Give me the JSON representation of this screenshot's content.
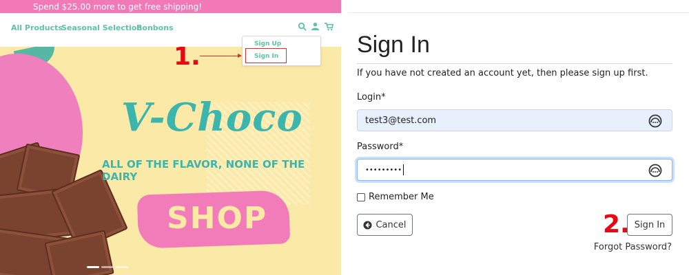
{
  "store": {
    "promo_text": "Spend $25.00 more to get free shipping!",
    "nav": [
      "All Products",
      "Seasonal Selection",
      "Bonbons"
    ],
    "icons": [
      "search-icon",
      "user-icon",
      "cart-icon"
    ],
    "account_menu": [
      "Sign Up",
      "Sign In"
    ],
    "hero": {
      "title": "V-Choco",
      "subtitle": "ALL OF THE FLAVOR, NONE OF THE DAIRY",
      "cta": "SHOP"
    },
    "step_one": "1.",
    "colors": {
      "promo": "#f279b8",
      "accent": "#5fc3a3",
      "hero_bg": "#fbe9a8",
      "pink": "#f27bba",
      "teal": "#3cb5ad",
      "annotation": "#e50914"
    }
  },
  "signin": {
    "title": "Sign In",
    "subtitle": "If you have not created an account yet, then please sign up first.",
    "login_label": "Login*",
    "login_value": "test3@test.com",
    "password_label": "Password*",
    "password_value": "•••••••••",
    "remember_label": "Remember Me",
    "remember_checked": false,
    "cancel_label": "Cancel",
    "signin_button": "Sign In",
    "forgot_link": "Forgot Password?",
    "step_two": "2."
  }
}
